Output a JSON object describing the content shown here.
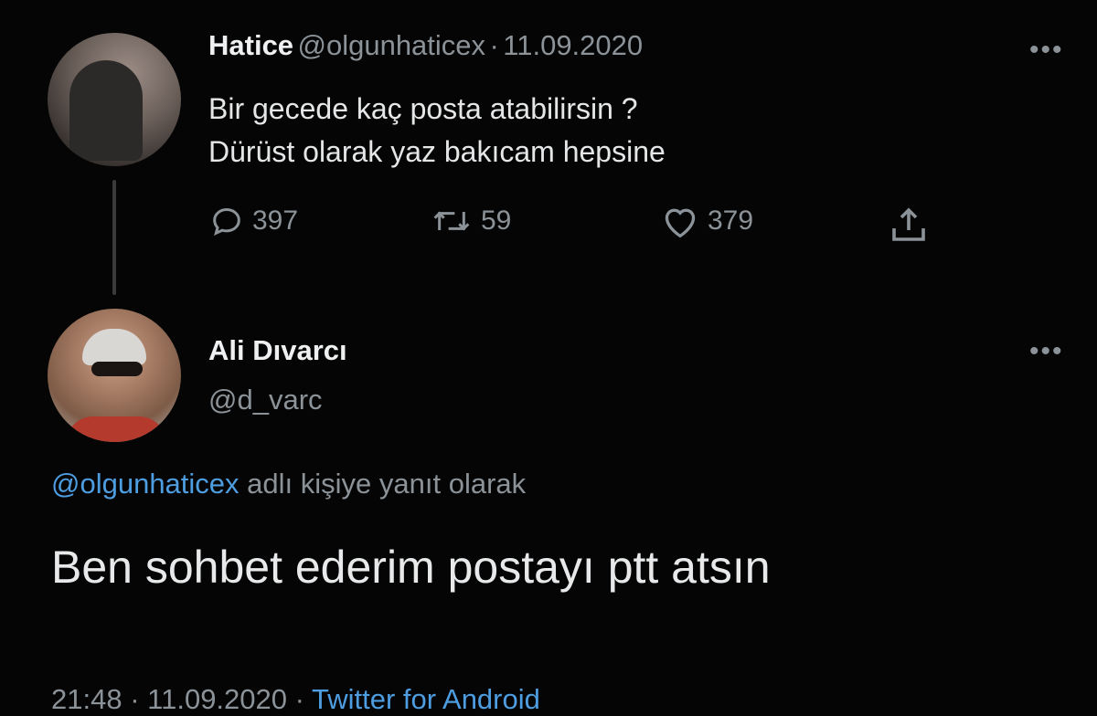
{
  "tweet1": {
    "name": "Hatice",
    "handle": "@olgunhaticex",
    "sep": "·",
    "date": "11.09.2020",
    "line1": "Bir gecede kaç posta atabilirsin ?",
    "line2": "Dürüst olarak yaz bakıcam hepsine",
    "replies": "397",
    "retweets": "59",
    "likes": "379",
    "more": "•••"
  },
  "tweet2": {
    "name": "Ali Dıvarcı",
    "handle": "@d_varc",
    "more": "•••",
    "reply_to_handle": "@olgunhaticex",
    "reply_to_text": "adlı kişiye yanıt olarak",
    "text": "Ben sohbet ederim postayı ptt atsın",
    "time": "21:48",
    "sep1": "·",
    "date": "11.09.2020",
    "sep2": "·",
    "source": "Twitter for Android"
  },
  "colors": {
    "background": "#050505",
    "link": "#4d9de0",
    "muted": "#8b9298"
  },
  "icons": [
    "reply-icon",
    "retweet-icon",
    "like-icon",
    "share-icon",
    "more-icon"
  ]
}
